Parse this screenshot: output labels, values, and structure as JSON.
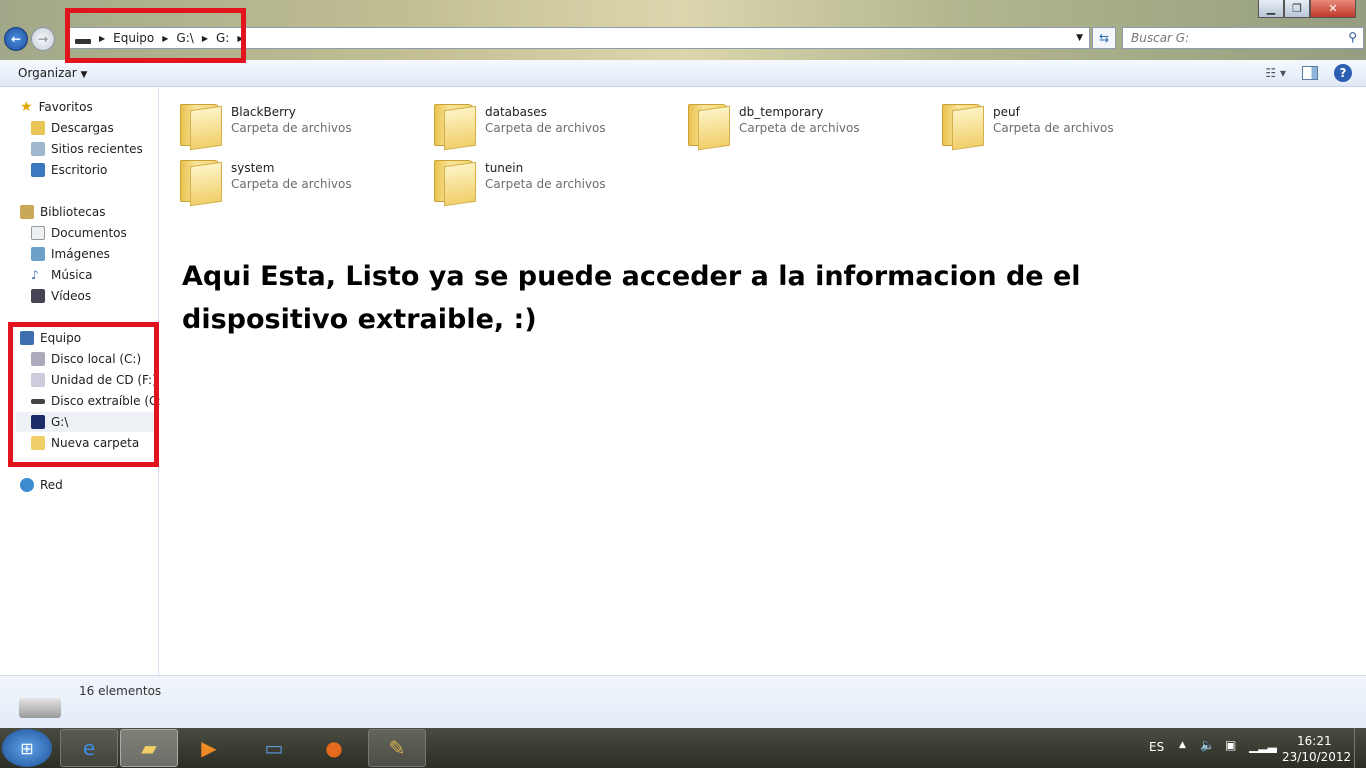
{
  "address": {
    "crumbs": [
      "Equipo",
      "G:\\",
      "G:"
    ]
  },
  "search": {
    "placeholder": "Buscar G:"
  },
  "toolbar": {
    "organize": "Organizar"
  },
  "sidebar": {
    "favorites": {
      "label": "Favoritos",
      "items": [
        "Descargas",
        "Sitios recientes",
        "Escritorio"
      ]
    },
    "libraries": {
      "label": "Bibliotecas",
      "items": [
        "Documentos",
        "Imágenes",
        "Música",
        "Vídeos"
      ]
    },
    "computer": {
      "label": "Equipo",
      "items": [
        "Disco local (C:)",
        "Unidad de CD (F:)",
        "Disco extraíble (G:)",
        "G:\\",
        "Nueva carpeta"
      ]
    },
    "network": {
      "label": "Red"
    }
  },
  "folders": [
    {
      "name": "BlackBerry",
      "type": "Carpeta de archivos"
    },
    {
      "name": "databases",
      "type": "Carpeta de archivos"
    },
    {
      "name": "db_temporary",
      "type": "Carpeta de archivos"
    },
    {
      "name": "peuf",
      "type": "Carpeta de archivos"
    },
    {
      "name": "system",
      "type": "Carpeta de archivos"
    },
    {
      "name": "tunein",
      "type": "Carpeta de archivos"
    }
  ],
  "note": "Aqui Esta, Listo ya se puede acceder a la informacion de el dispositivo extraible, :)",
  "status": {
    "count": "16 elementos"
  },
  "tray": {
    "lang": "ES",
    "time": "16:21",
    "date": "23/10/2012"
  }
}
